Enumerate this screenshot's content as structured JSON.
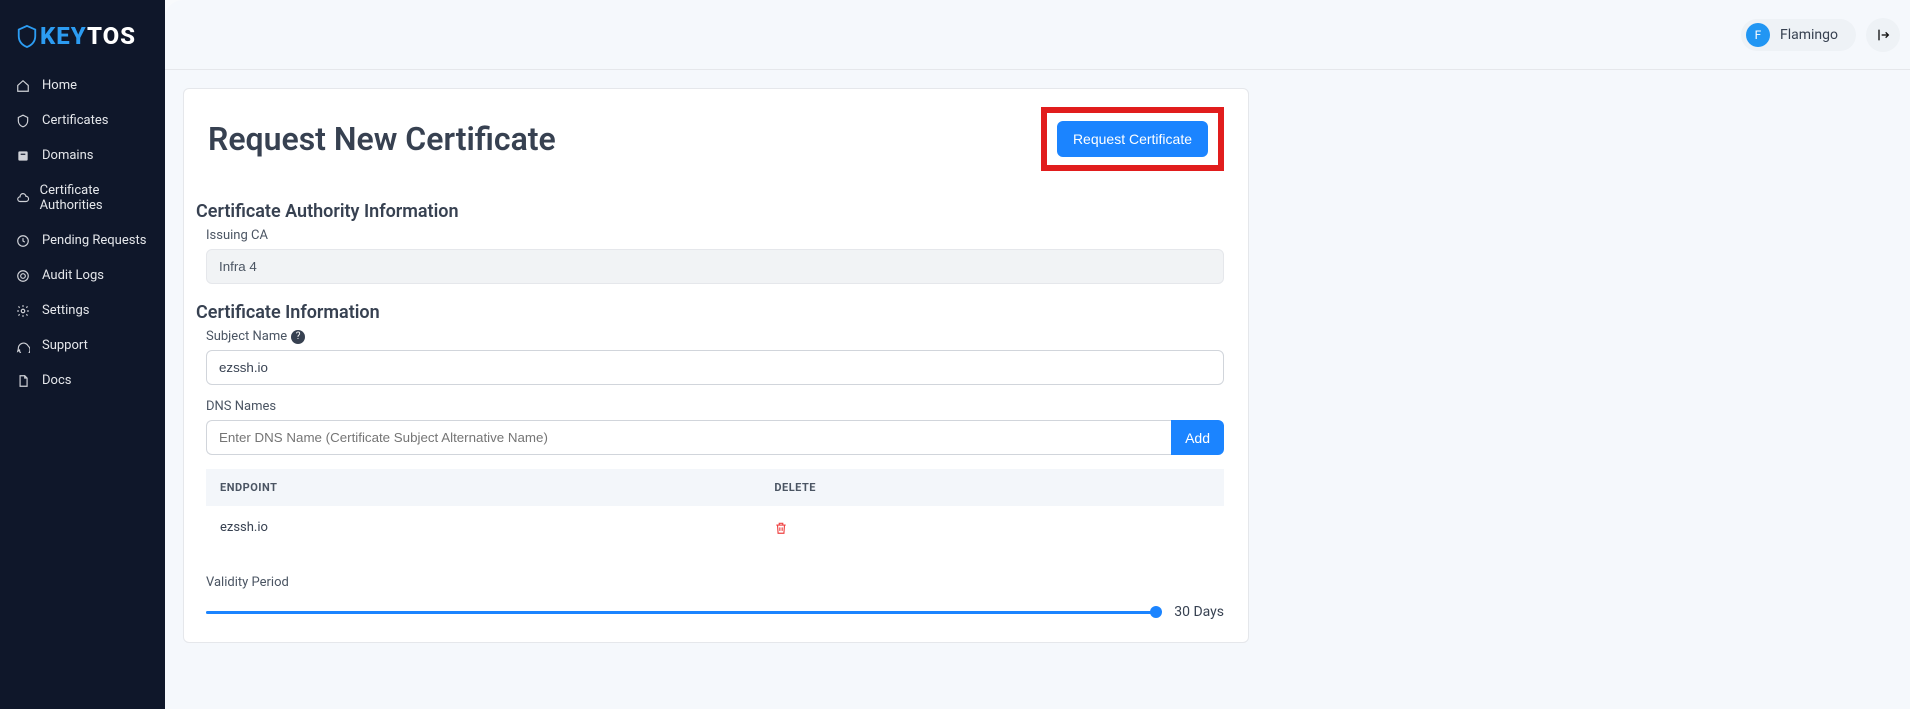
{
  "brand": {
    "name": "KEYTOS"
  },
  "sidebar": {
    "items": [
      {
        "label": "Home",
        "icon": "home-icon"
      },
      {
        "label": "Certificates",
        "icon": "shield-icon"
      },
      {
        "label": "Domains",
        "icon": "domain-icon"
      },
      {
        "label": "Certificate Authorities",
        "icon": "cloud-icon"
      },
      {
        "label": "Pending Requests",
        "icon": "clock-icon"
      },
      {
        "label": "Audit Logs",
        "icon": "target-icon"
      },
      {
        "label": "Settings",
        "icon": "gear-icon"
      },
      {
        "label": "Support",
        "icon": "chat-icon"
      },
      {
        "label": "Docs",
        "icon": "doc-icon"
      }
    ]
  },
  "user": {
    "initial": "F",
    "name": "Flamingo"
  },
  "page": {
    "title": "Request New Certificate",
    "request_button": "Request Certificate"
  },
  "ca_section": {
    "title": "Certificate Authority Information",
    "issuing_label": "Issuing CA",
    "issuing_value": "Infra 4"
  },
  "cert_section": {
    "title": "Certificate Information",
    "subject_label": "Subject Name",
    "subject_value": "ezssh.io",
    "dns_label": "DNS Names",
    "dns_placeholder": "Enter DNS Name (Certificate Subject Alternative Name)",
    "add_label": "Add",
    "table": {
      "col_endpoint": "ENDPOINT",
      "col_delete": "DELETE",
      "rows": [
        {
          "endpoint": "ezssh.io"
        }
      ]
    },
    "validity_label": "Validity Period",
    "validity_value": "30 Days"
  }
}
